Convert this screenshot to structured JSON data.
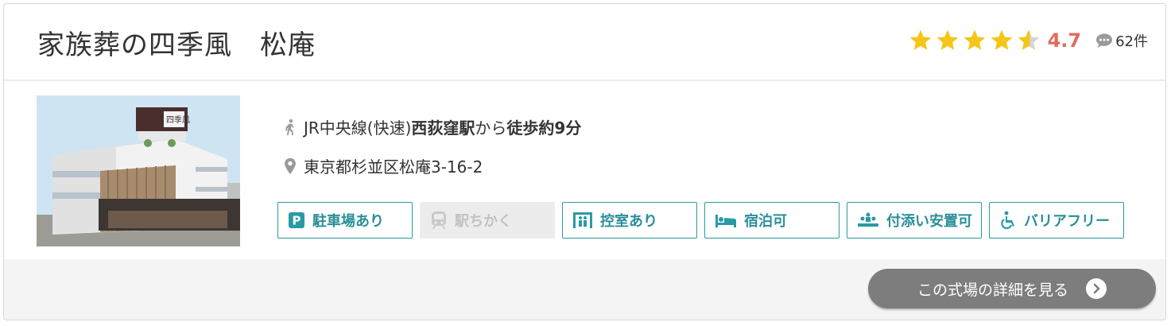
{
  "listing": {
    "title": "家族葬の四季風　松庵",
    "rating": {
      "stars": 4.7,
      "score": "4.7",
      "review_count": "62件"
    },
    "access": {
      "line": "JR中央線(快速) ",
      "station": "西荻窪駅",
      "from": "から",
      "walk": "徒歩約9分"
    },
    "address": "東京都杉並区松庵3-16-2",
    "photo_sign": "四季風",
    "features": [
      {
        "label": "駐車場あり",
        "icon": "parking-icon",
        "available": true
      },
      {
        "label": "駅ちかく",
        "icon": "train-icon",
        "available": false
      },
      {
        "label": "控室あり",
        "icon": "waiting-room-icon",
        "available": true
      },
      {
        "label": "宿泊可",
        "icon": "bed-icon",
        "available": true
      },
      {
        "label": "付添い安置可",
        "icon": "attendance-icon",
        "available": true
      },
      {
        "label": "バリアフリー",
        "icon": "wheelchair-icon",
        "available": true
      }
    ],
    "detail_button": "この式場の詳細を見る"
  },
  "colors": {
    "accent": "#2a9aa5",
    "star": "#f5c518",
    "score": "#e26a5e",
    "button": "#7d7d7d"
  }
}
